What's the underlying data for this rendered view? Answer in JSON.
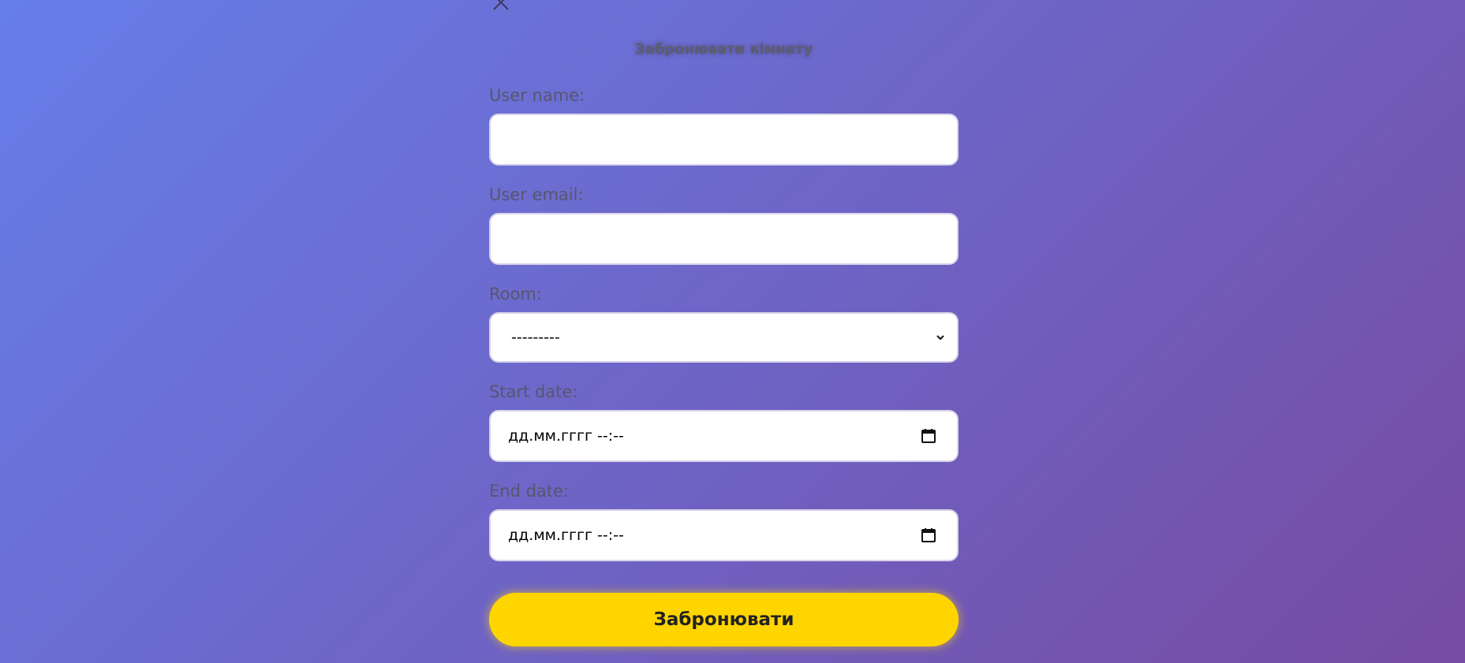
{
  "dialog": {
    "title": "Забронювати кімнату",
    "close_icon": "close-icon"
  },
  "form": {
    "user_name": {
      "label": "User name:",
      "value": ""
    },
    "user_email": {
      "label": "User email:",
      "value": ""
    },
    "room": {
      "label": "Room:",
      "selected": "---------",
      "icon": "chevron-down-icon"
    },
    "start_date": {
      "label": "Start date:",
      "placeholder": "дд.мм.гггг --:--",
      "icon": "calendar-icon"
    },
    "end_date": {
      "label": "End date:",
      "placeholder": "дд.мм.гггг --:--",
      "icon": "calendar-icon"
    },
    "submit_label": "Забронювати"
  },
  "colors": {
    "background_start": "#667eea",
    "background_end": "#764ba2",
    "accent": "#ffd500"
  }
}
